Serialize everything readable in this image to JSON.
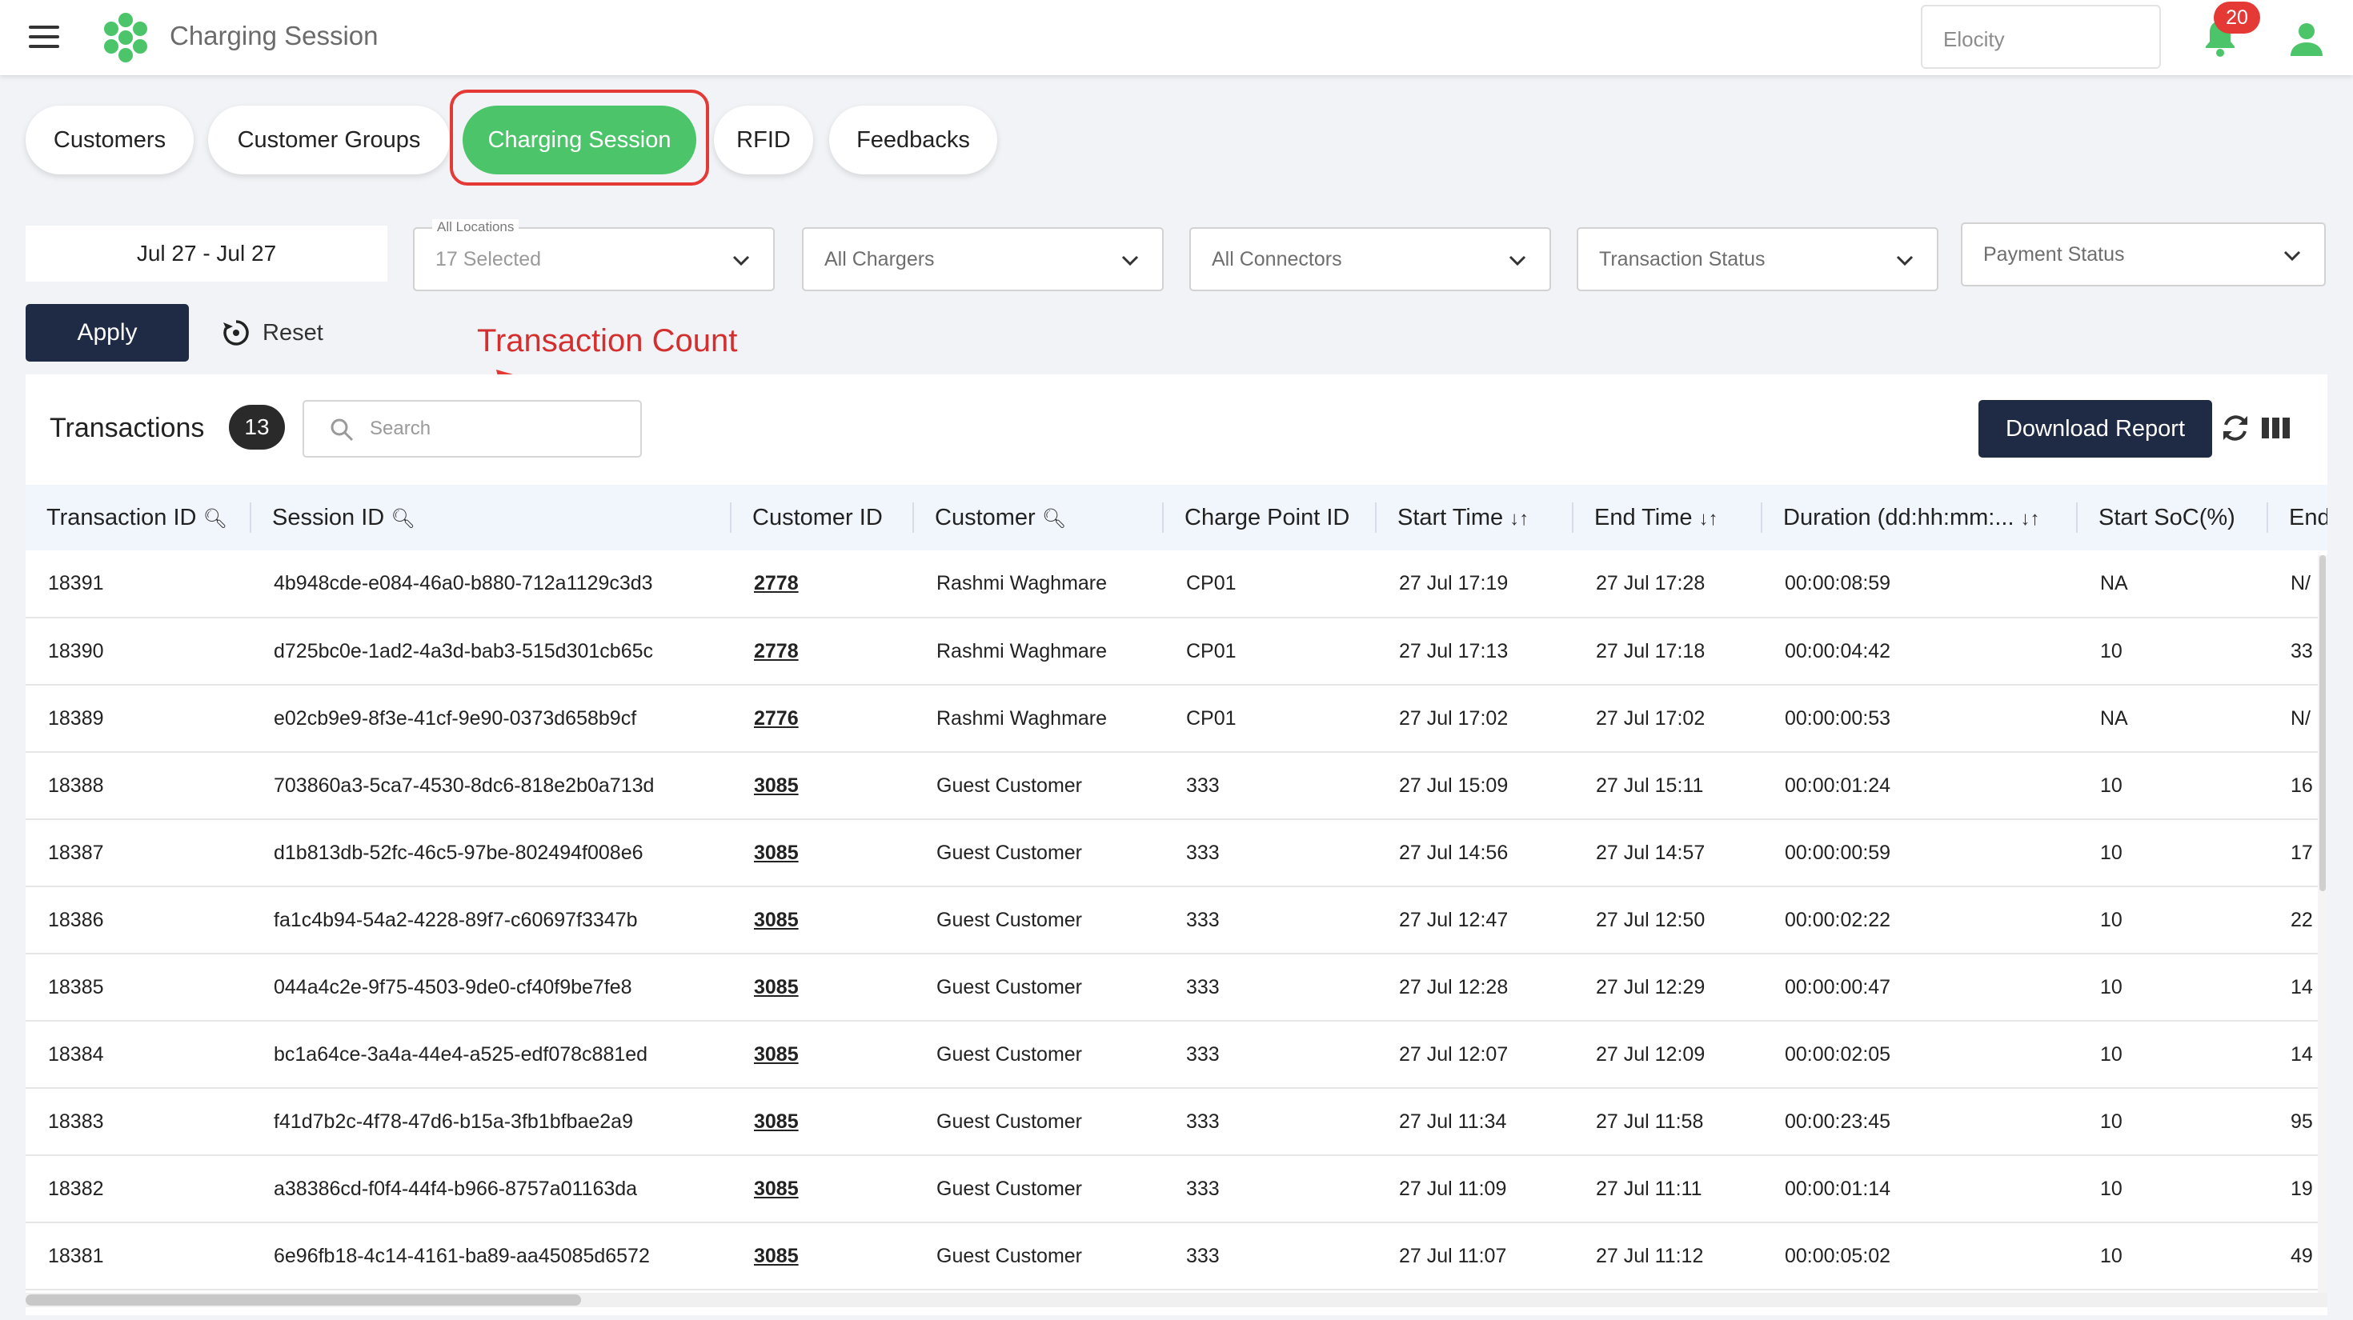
{
  "header": {
    "app_title": "Charging Session",
    "tenant_value": "Elocity",
    "notifications_count": "20",
    "brand_color": "#4cc46a",
    "icons": [
      "menu-icon",
      "logo-icon",
      "bell-icon",
      "user-icon"
    ]
  },
  "tabs": [
    {
      "label": "Customers",
      "active": false
    },
    {
      "label": "Customer Groups",
      "active": false
    },
    {
      "label": "Charging Session",
      "active": true
    },
    {
      "label": "RFID",
      "active": false
    },
    {
      "label": "Feedbacks",
      "active": false
    }
  ],
  "filters": {
    "date_range": "Jul 27 - Jul 27",
    "locations": {
      "legend": "All Locations",
      "value": "17 Selected"
    },
    "chargers": "All Chargers",
    "connectors": "All Connectors",
    "transaction_status": "Transaction Status",
    "payment_status": "Payment Status",
    "apply_label": "Apply",
    "reset_label": "Reset"
  },
  "annotation": {
    "text": "Transaction Count",
    "color": "#d32f2f"
  },
  "panel": {
    "title": "Transactions",
    "count": "13",
    "search_placeholder": "Search",
    "download_label": "Download Report"
  },
  "table": {
    "columns": [
      "Transaction ID",
      "Session ID",
      "Customer ID",
      "Customer",
      "Charge Point ID",
      "Start Time",
      "End Time",
      "Duration (dd:hh:mm:...",
      "Start SoC(%)",
      "End"
    ],
    "rows": [
      [
        "18391",
        "4b948cde-e084-46a0-b880-712a1129c3d3",
        "2778",
        "Rashmi Waghmare",
        "CP01",
        "27 Jul 17:19",
        "27 Jul 17:28",
        "00:00:08:59",
        "NA",
        "N/"
      ],
      [
        "18390",
        "d725bc0e-1ad2-4a3d-bab3-515d301cb65c",
        "2778",
        "Rashmi Waghmare",
        "CP01",
        "27 Jul 17:13",
        "27 Jul 17:18",
        "00:00:04:42",
        "10",
        "33"
      ],
      [
        "18389",
        "e02cb9e9-8f3e-41cf-9e90-0373d658b9cf",
        "2776",
        "Rashmi Waghmare",
        "CP01",
        "27 Jul 17:02",
        "27 Jul 17:02",
        "00:00:00:53",
        "NA",
        "N/"
      ],
      [
        "18388",
        "703860a3-5ca7-4530-8dc6-818e2b0a713d",
        "3085",
        "Guest Customer",
        "333",
        "27 Jul 15:09",
        "27 Jul 15:11",
        "00:00:01:24",
        "10",
        "16"
      ],
      [
        "18387",
        "d1b813db-52fc-46c5-97be-802494f008e6",
        "3085",
        "Guest Customer",
        "333",
        "27 Jul 14:56",
        "27 Jul 14:57",
        "00:00:00:59",
        "10",
        "17"
      ],
      [
        "18386",
        "fa1c4b94-54a2-4228-89f7-c60697f3347b",
        "3085",
        "Guest Customer",
        "333",
        "27 Jul 12:47",
        "27 Jul 12:50",
        "00:00:02:22",
        "10",
        "22"
      ],
      [
        "18385",
        "044a4c2e-9f75-4503-9de0-cf40f9be7fe8",
        "3085",
        "Guest Customer",
        "333",
        "27 Jul 12:28",
        "27 Jul 12:29",
        "00:00:00:47",
        "10",
        "14"
      ],
      [
        "18384",
        "bc1a64ce-3a4a-44e4-a525-edf078c881ed",
        "3085",
        "Guest Customer",
        "333",
        "27 Jul 12:07",
        "27 Jul 12:09",
        "00:00:02:05",
        "10",
        "14"
      ],
      [
        "18383",
        "f41d7b2c-4f78-47d6-b15a-3fb1bfbae2a9",
        "3085",
        "Guest Customer",
        "333",
        "27 Jul 11:34",
        "27 Jul 11:58",
        "00:00:23:45",
        "10",
        "95"
      ],
      [
        "18382",
        "a38386cd-f0f4-44f4-b966-8757a01163da",
        "3085",
        "Guest Customer",
        "333",
        "27 Jul 11:09",
        "27 Jul 11:11",
        "00:00:01:14",
        "10",
        "19"
      ],
      [
        "18381",
        "6e96fb18-4c14-4161-ba89-aa45085d6572",
        "3085",
        "Guest Customer",
        "333",
        "27 Jul 11:07",
        "27 Jul 11:12",
        "00:00:05:02",
        "10",
        "49"
      ]
    ]
  }
}
